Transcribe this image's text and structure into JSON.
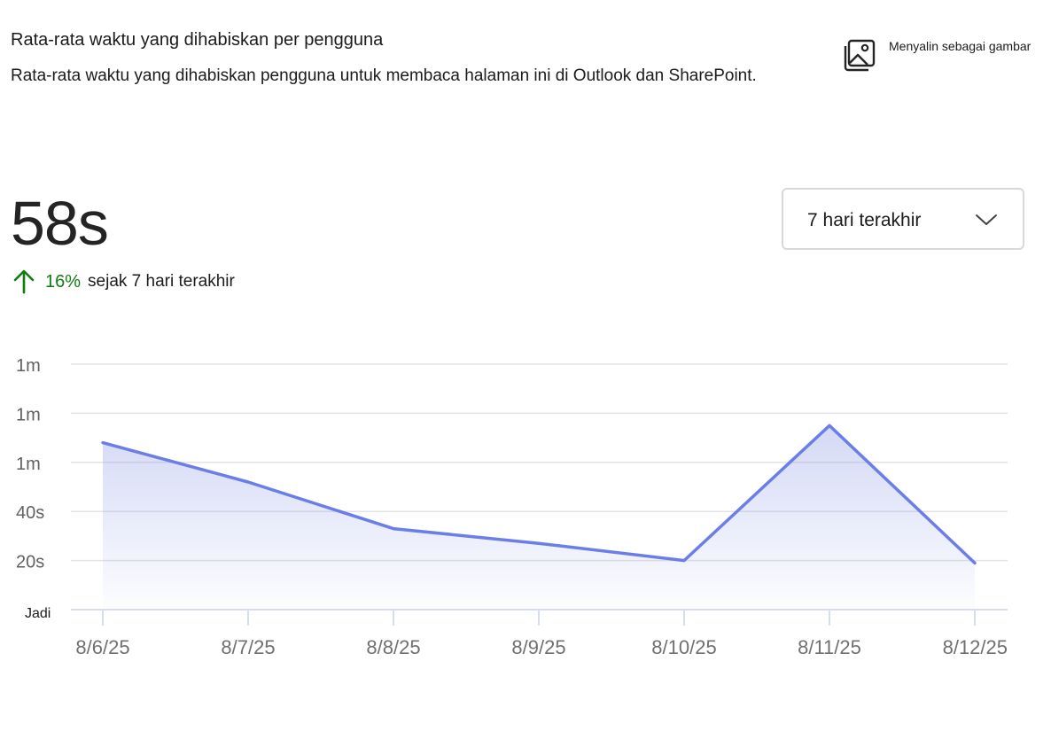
{
  "header": {
    "title": "Rata-rata waktu yang dihabiskan per pengguna",
    "subtitle": "Rata-rata waktu yang dihabiskan pengguna untuk membaca halaman ini di Outlook dan SharePoint.",
    "copy_label": "Menyalin sebagai gambar",
    "copy_icon": "image-icon"
  },
  "summary": {
    "value": "58s",
    "change": "16%",
    "change_direction": "up",
    "change_color": "#107c10",
    "since": "sejak 7 hari terakhir"
  },
  "range_select": {
    "selected": "7 hari terakhir",
    "icon": "chevron-down-icon"
  },
  "chart_data": {
    "type": "area",
    "title": "",
    "xlabel": "",
    "ylabel": "",
    "x": [
      "8/6/25",
      "8/7/25",
      "8/8/25",
      "8/9/25",
      "8/10/25",
      "8/11/25",
      "8/12/25"
    ],
    "series": [
      {
        "values": [
          68,
          52,
          33,
          27,
          20,
          75,
          19
        ]
      }
    ],
    "ylim": [
      0,
      100
    ],
    "y_ticks": [
      0,
      20,
      40,
      60,
      80,
      100
    ],
    "y_tick_labels": [
      "Jadi",
      "20s",
      "40s",
      "1m",
      "1m",
      "1m"
    ],
    "grid": true,
    "line_color": "#6b7ee8",
    "fill_color": "#8c9ae6"
  }
}
